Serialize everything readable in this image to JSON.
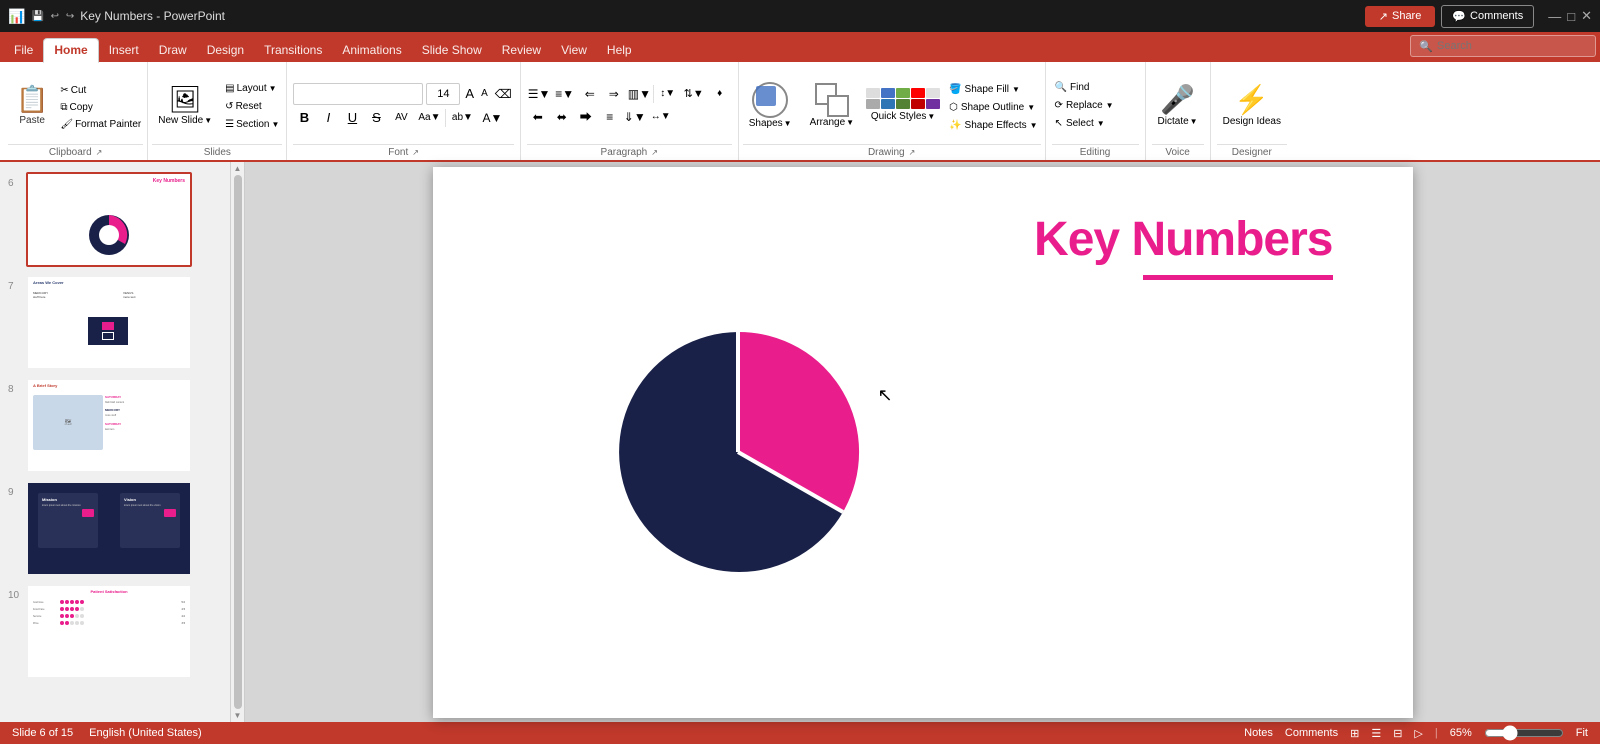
{
  "titlebar": {
    "left": "🔄 ⬅ ➡",
    "center": "Key Numbers - PowerPoint",
    "share": "Share",
    "comments": "Comments",
    "close": "✕",
    "minimize": "—",
    "maximize": "□"
  },
  "menu": {
    "tabs": [
      "File",
      "Home",
      "Insert",
      "Draw",
      "Design",
      "Transitions",
      "Animations",
      "Slide Show",
      "Review",
      "View",
      "Help"
    ]
  },
  "ribbon": {
    "active_tab": "Home",
    "groups": {
      "clipboard": {
        "label": "Clipboard",
        "paste_label": "Paste",
        "cut_label": "Cut",
        "copy_label": "Copy",
        "format_painter_label": "Format Painter"
      },
      "slides": {
        "label": "Slides",
        "new_slide_label": "New\nSlide",
        "layout_label": "Layout",
        "reset_label": "Reset",
        "section_label": "Section"
      },
      "font": {
        "label": "Font",
        "font_name": "",
        "font_size": "14",
        "bold": "B",
        "italic": "I",
        "underline": "U",
        "strikethrough": "S",
        "increase_size": "A↑",
        "decrease_size": "A↓",
        "clear_format": "⌫",
        "char_spacing": "AV",
        "text_case": "Aa",
        "highlight": "ab",
        "font_color": "A"
      },
      "paragraph": {
        "label": "Paragraph",
        "bullets": "☰",
        "numbering": "1.",
        "decrease_indent": "⇐",
        "increase_indent": "⇒",
        "columns": "▥",
        "line_spacing": "↕",
        "align_left": "⬅",
        "align_center": "⬌",
        "align_right": "⮕",
        "justify": "≡",
        "text_direction": "⇓",
        "convert_smartart": "♦"
      },
      "drawing": {
        "label": "Drawing",
        "shapes_label": "Shapes",
        "arrange_label": "Arrange",
        "quick_styles_label": "Quick\nStyles",
        "shape_fill_label": "Shape Fill",
        "shape_outline_label": "Shape Outline",
        "shape_effects_label": "Shape Effects"
      },
      "editing": {
        "label": "Editing",
        "find_label": "Find",
        "replace_label": "Replace",
        "select_label": "Select"
      },
      "voice": {
        "label": "Voice",
        "dictate_label": "Dictate"
      },
      "designer": {
        "label": "Designer",
        "design_ideas_label": "Design\nIdeas"
      }
    }
  },
  "slides": [
    {
      "num": "6",
      "title": "Key Numbers",
      "active": true
    },
    {
      "num": "7",
      "title": "Areas We Cover",
      "active": false
    },
    {
      "num": "8",
      "title": "A Brief Story",
      "active": false
    },
    {
      "num": "9",
      "title": "Mission / Vision",
      "active": false
    },
    {
      "num": "10",
      "title": "Patient Satisfaction",
      "active": false
    }
  ],
  "current_slide": {
    "title": "Key Numbers",
    "pie_chart": {
      "dark_segment": 65,
      "pink_segment": 35,
      "dark_color": "#1a2148",
      "pink_color": "#e91e8c"
    }
  },
  "statusbar": {
    "slide_count": "Slide 6 of 15",
    "language": "English (United States)",
    "notes": "Notes",
    "comments": "Comments",
    "zoom": "65%",
    "fit": "Fit"
  },
  "search": {
    "placeholder": "Search"
  },
  "colors": {
    "ribbon_bg": "#c0392b",
    "accent_pink": "#e91e8c",
    "accent_dark": "#1a2148",
    "tab_active": "white"
  }
}
